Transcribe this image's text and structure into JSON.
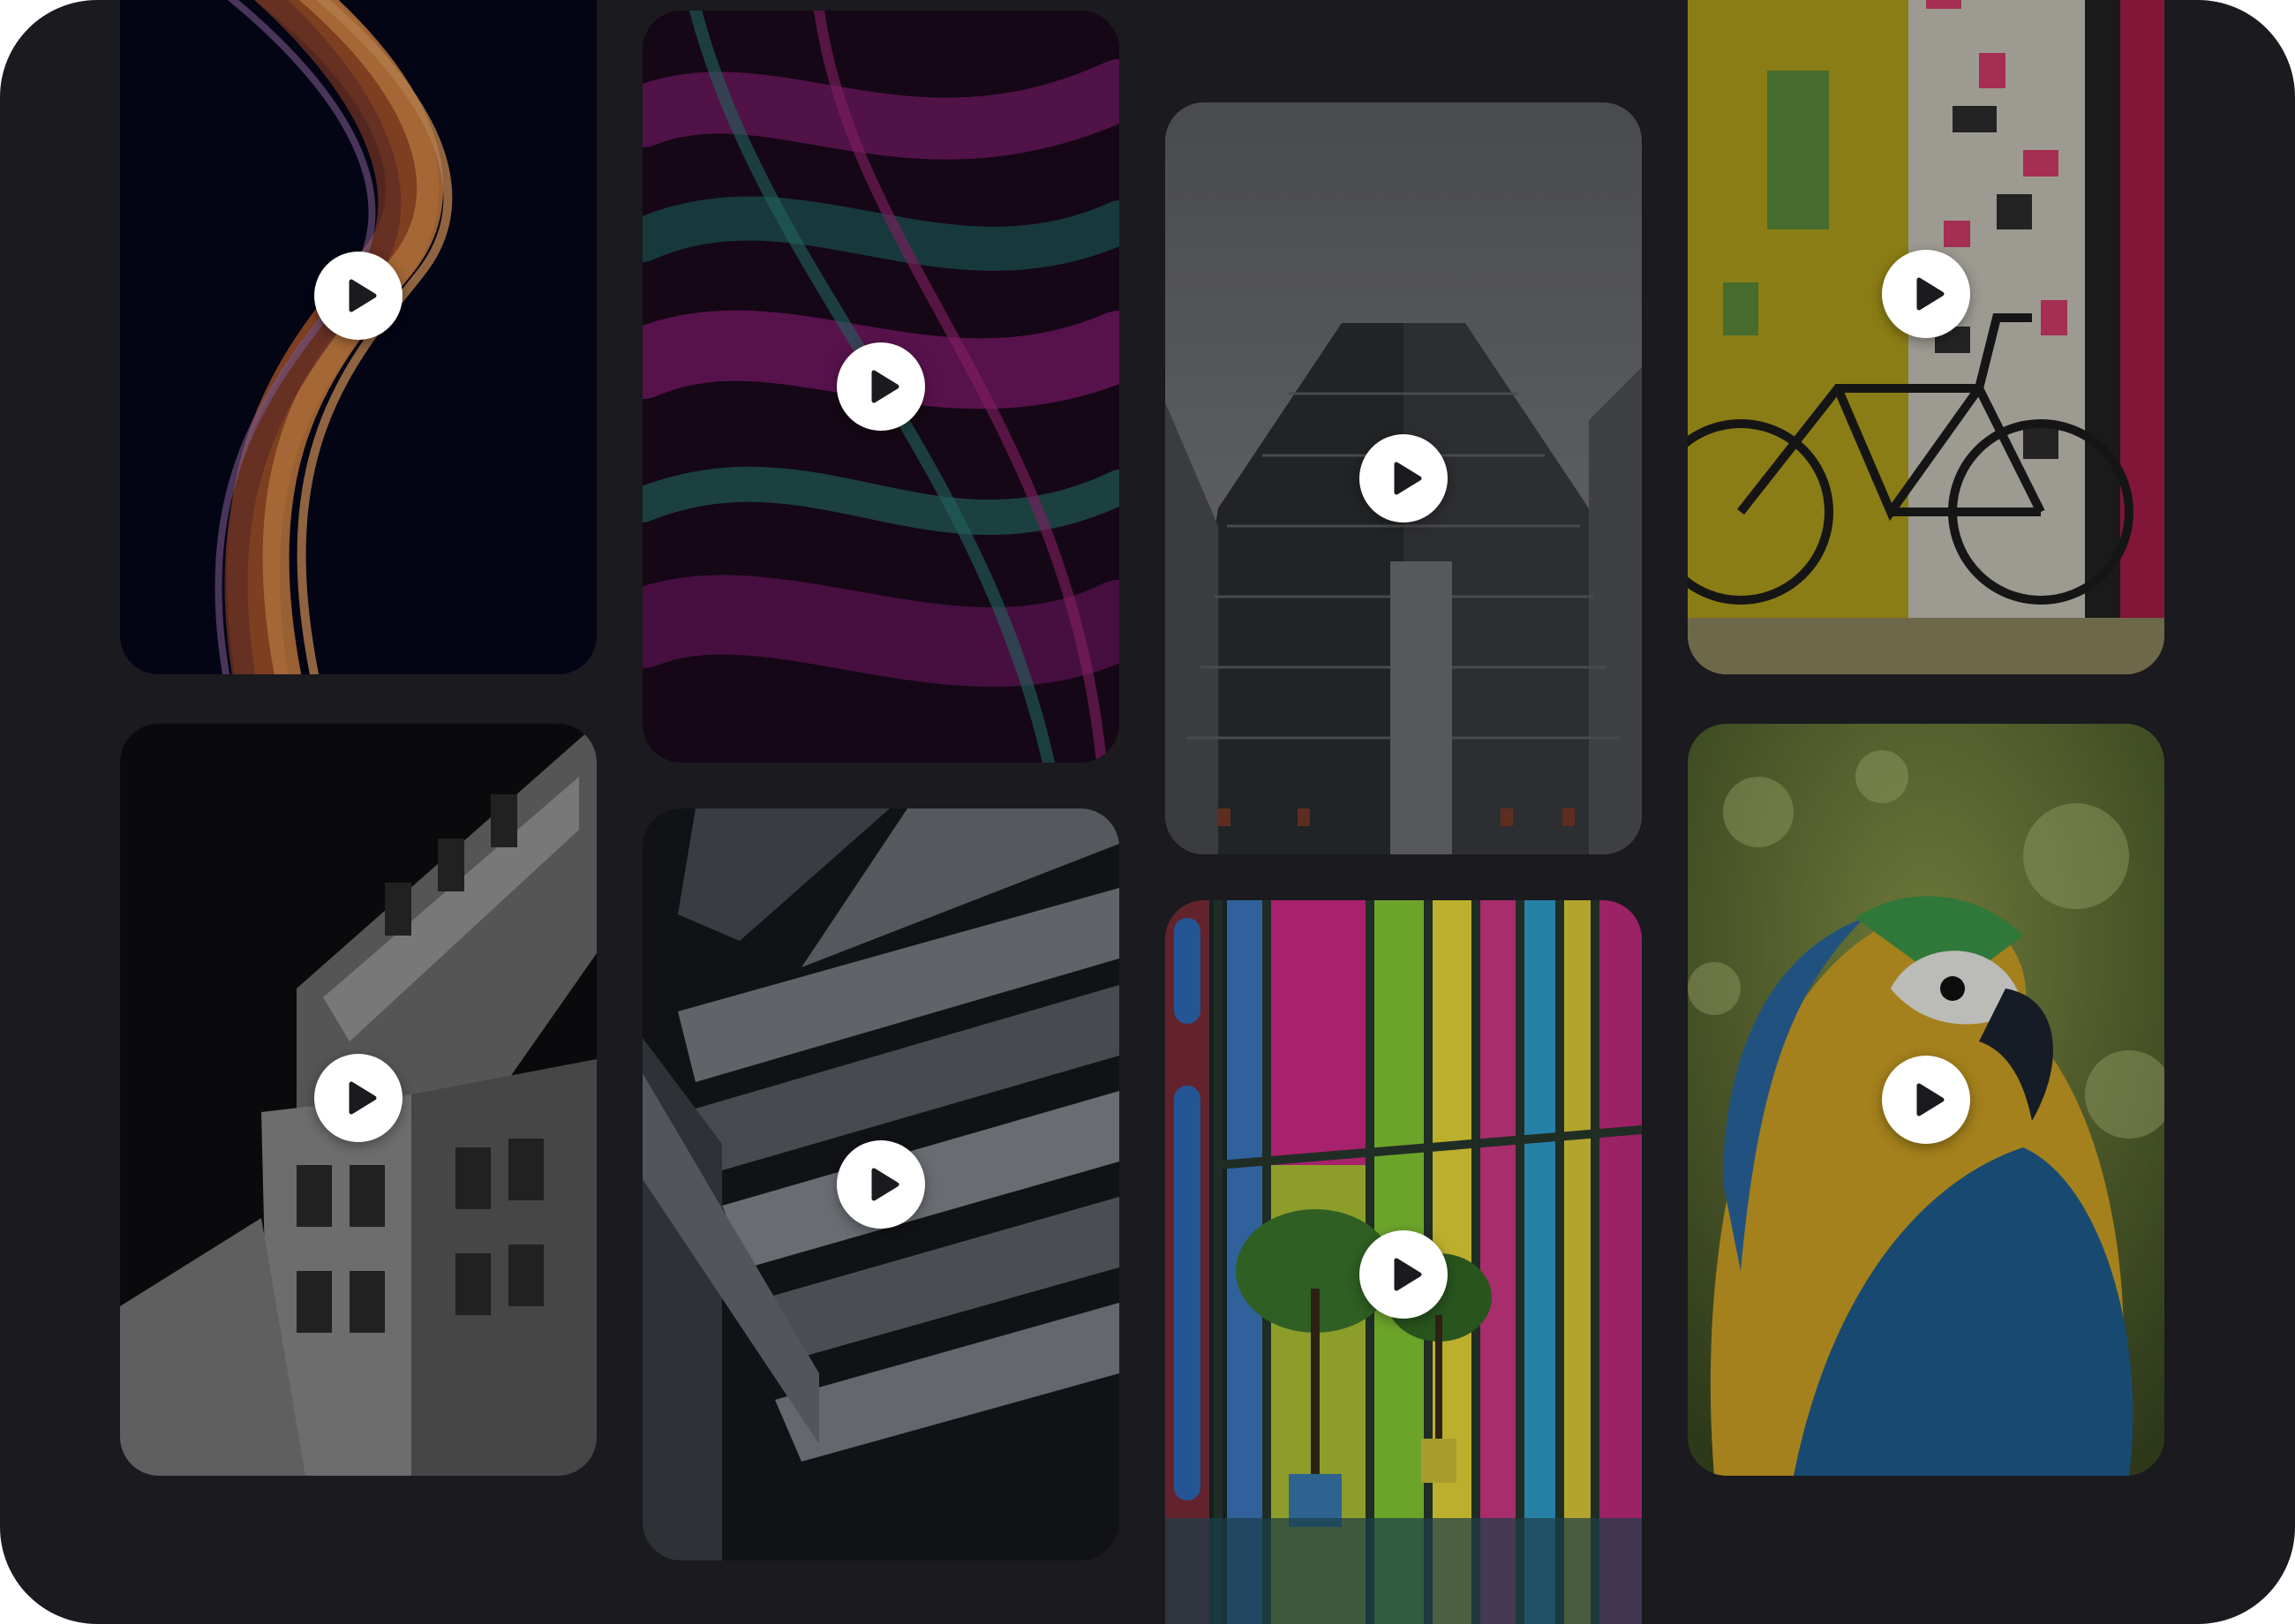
{
  "gallery": {
    "background": "#1a1a1f",
    "play_icon": "play-icon",
    "items": [
      {
        "id": "c1",
        "subject": "orange-wave"
      },
      {
        "id": "c2",
        "subject": "bw-building"
      },
      {
        "id": "c3",
        "subject": "magenta-teal-texture"
      },
      {
        "id": "c4",
        "subject": "grey-architecture"
      },
      {
        "id": "c5",
        "subject": "glass-tower"
      },
      {
        "id": "c6",
        "subject": "colorful-windows"
      },
      {
        "id": "c7",
        "subject": "yellow-wall-bicycle"
      },
      {
        "id": "c8",
        "subject": "macaw-parrot"
      }
    ]
  }
}
